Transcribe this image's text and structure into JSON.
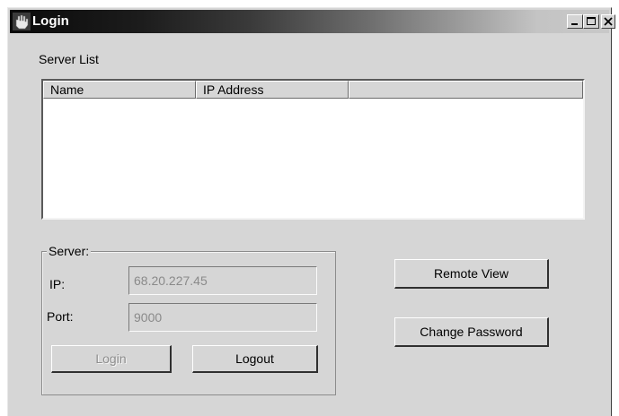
{
  "window": {
    "title": "Login"
  },
  "server_list": {
    "label": "Server List",
    "columns": [
      "Name",
      "IP Address",
      ""
    ],
    "rows": []
  },
  "server_group": {
    "legend": "Server:",
    "ip_label": "IP:",
    "ip_value": "68.20.227.45",
    "port_label": "Port:",
    "port_value": "9000",
    "login_label": "Login",
    "logout_label": "Logout"
  },
  "actions": {
    "remote_view_label": "Remote View",
    "change_password_label": "Change Password"
  },
  "icons": {
    "app": "hand-icon",
    "minimize": "minimize-icon",
    "maximize": "maximize-icon",
    "close": "close-icon"
  }
}
